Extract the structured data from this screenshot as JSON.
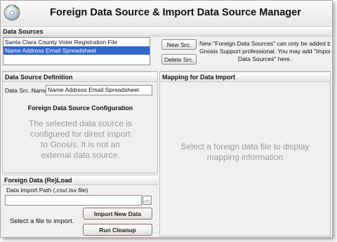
{
  "window": {
    "title": "Foreign Data Source & Import Data Source Manager",
    "icon": "disc-icon"
  },
  "data_sources": {
    "header": "Data Sources",
    "items": [
      {
        "label": "Santa Clara County Voter Registration File",
        "selected": false
      },
      {
        "label": "Name Address Email Spreadsheet",
        "selected": true
      }
    ],
    "new_button": "New Src.",
    "delete_button": "Delete Src.",
    "note_lines": [
      "New \"Foreign Data Sources\" can only be added by",
      "Gnosis Support professional. You may add \"Import",
      "Data Sources\" here."
    ]
  },
  "definition": {
    "header": "Data Source Definition",
    "name_label": "Data Src. Name",
    "name_value": "Name Address Email Spreadsheet",
    "config_title": "Foreign Data Source Configuration",
    "config_message_lines": [
      "The selected data source is",
      "configured for direct import",
      "to Gnosis. It is not an",
      "external data source."
    ]
  },
  "mapping": {
    "header": "Mapping for Data Import",
    "message_lines": [
      "Select a foreign data file to display",
      "mapping information"
    ]
  },
  "reload": {
    "header": "Foreign Data (Re)Load",
    "path_label": "Data Import Path (.csv/.tsv file)",
    "path_value": "",
    "browse_label": "...",
    "status_text": "Select a file to import.",
    "import_button": "Import New Data",
    "cleanup_button": "Run Cleanup"
  }
}
